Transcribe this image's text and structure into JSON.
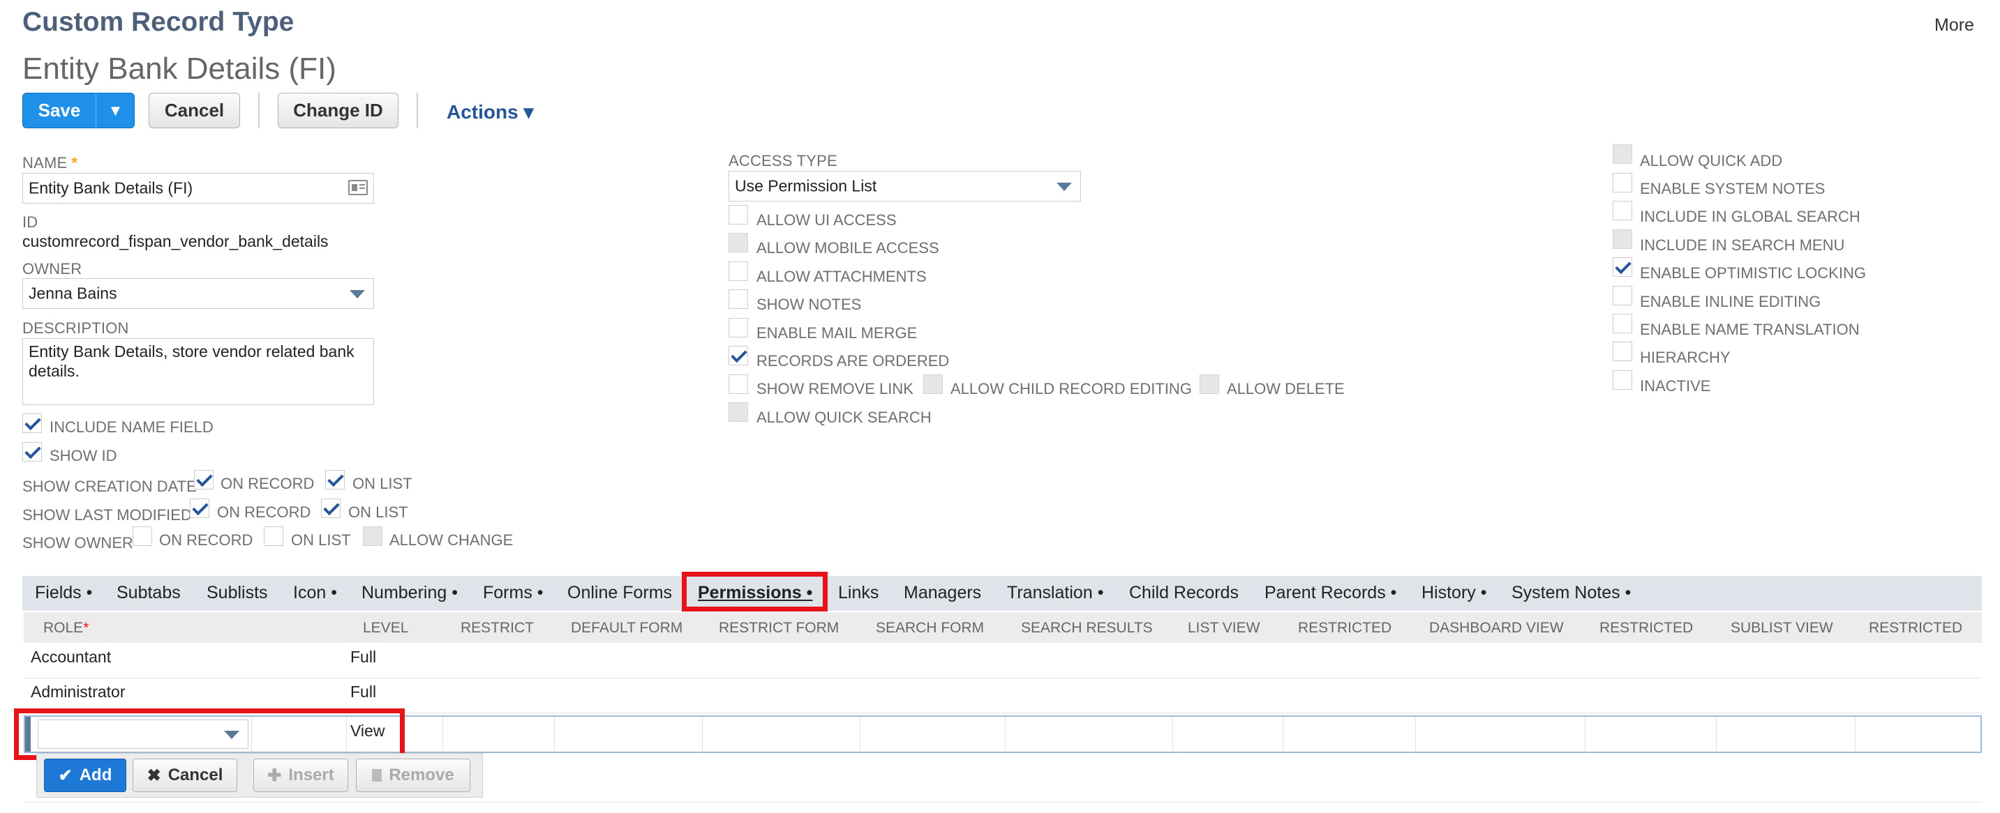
{
  "header": {
    "page_type": "Custom Record Type",
    "more": "More",
    "record_title": "Entity Bank Details (FI)"
  },
  "toolbar": {
    "save": "Save",
    "save_menu_icon": "dropdown-triangle",
    "cancel": "Cancel",
    "change_id": "Change ID",
    "actions": "Actions ▾"
  },
  "primary": {
    "name_label": "NAME",
    "name_required": "*",
    "name_value": "Entity Bank Details (FI)",
    "id_label": "ID",
    "id_value": "customrecord_fispan_vendor_bank_details",
    "owner_label": "OWNER",
    "owner_value": "Jenna Bains",
    "description_label": "DESCRIPTION",
    "description_value": "Entity Bank Details, store vendor related bank details.",
    "include_name_field": "INCLUDE NAME FIELD",
    "show_id": "SHOW ID",
    "show_creation_date": "SHOW CREATION DATE",
    "show_last_modified": "SHOW LAST MODIFIED",
    "show_owner": "SHOW OWNER",
    "on_record": "ON RECORD",
    "on_list": "ON LIST",
    "allow_change": "ALLOW CHANGE"
  },
  "access": {
    "access_type_label": "ACCESS TYPE",
    "access_type_value": "Use Permission List",
    "allow_ui_access": "ALLOW UI ACCESS",
    "allow_mobile_access": "ALLOW MOBILE ACCESS",
    "allow_attachments": "ALLOW ATTACHMENTS",
    "show_notes": "SHOW NOTES",
    "enable_mail_merge": "ENABLE MAIL MERGE",
    "records_are_ordered": "RECORDS ARE ORDERED",
    "show_remove_link": "SHOW REMOVE LINK",
    "allow_child_record_editing": "ALLOW CHILD RECORD EDITING",
    "allow_delete": "ALLOW DELETE",
    "allow_quick_search": "ALLOW QUICK SEARCH"
  },
  "options": {
    "allow_quick_add": "ALLOW QUICK ADD",
    "enable_system_notes": "ENABLE SYSTEM NOTES",
    "include_in_global_search": "INCLUDE IN GLOBAL SEARCH",
    "include_in_search_menu": "INCLUDE IN SEARCH MENU",
    "enable_optimistic_locking": "ENABLE OPTIMISTIC LOCKING",
    "enable_inline_editing": "ENABLE INLINE EDITING",
    "enable_name_translation": "ENABLE NAME TRANSLATION",
    "hierarchy": "HIERARCHY",
    "inactive": "INACTIVE"
  },
  "subtabs": {
    "fields": "Fields •",
    "subtabs": "Subtabs",
    "sublists": "Sublists",
    "icon": "Icon •",
    "numbering": "Numbering •",
    "forms": "Forms •",
    "online_forms": "Online Forms",
    "permissions": "Permissions •",
    "links": "Links",
    "managers": "Managers",
    "translation": "Translation •",
    "child_records": "Child Records",
    "parent_records": "Parent Records •",
    "history": "History •",
    "system_notes": "System Notes •"
  },
  "permissions": {
    "columns": {
      "role": "ROLE",
      "role_required": "*",
      "level": "LEVEL",
      "restrict": "RESTRICT",
      "default_form": "DEFAULT FORM",
      "restrict_form": "RESTRICT FORM",
      "search_form": "SEARCH FORM",
      "search_results": "SEARCH RESULTS",
      "list_view": "LIST VIEW",
      "restricted_1": "RESTRICTED",
      "dashboard_view": "DASHBOARD VIEW",
      "restricted_2": "RESTRICTED",
      "sublist_view": "SUBLIST VIEW",
      "restricted_3": "RESTRICTED"
    },
    "rows": [
      {
        "role": "Accountant",
        "level": "Full"
      },
      {
        "role": "Administrator",
        "level": "Full"
      }
    ],
    "edit_row": {
      "role": "",
      "level": "View"
    },
    "buttons": {
      "add": "Add",
      "cancel": "Cancel",
      "insert": "Insert",
      "remove": "Remove"
    }
  },
  "colors": {
    "title": "#4d5f79",
    "primary_button": "#1e90e8",
    "highlight": "#e8121b",
    "checkmark": "#255599",
    "tabbar": "#dfe4eb"
  }
}
